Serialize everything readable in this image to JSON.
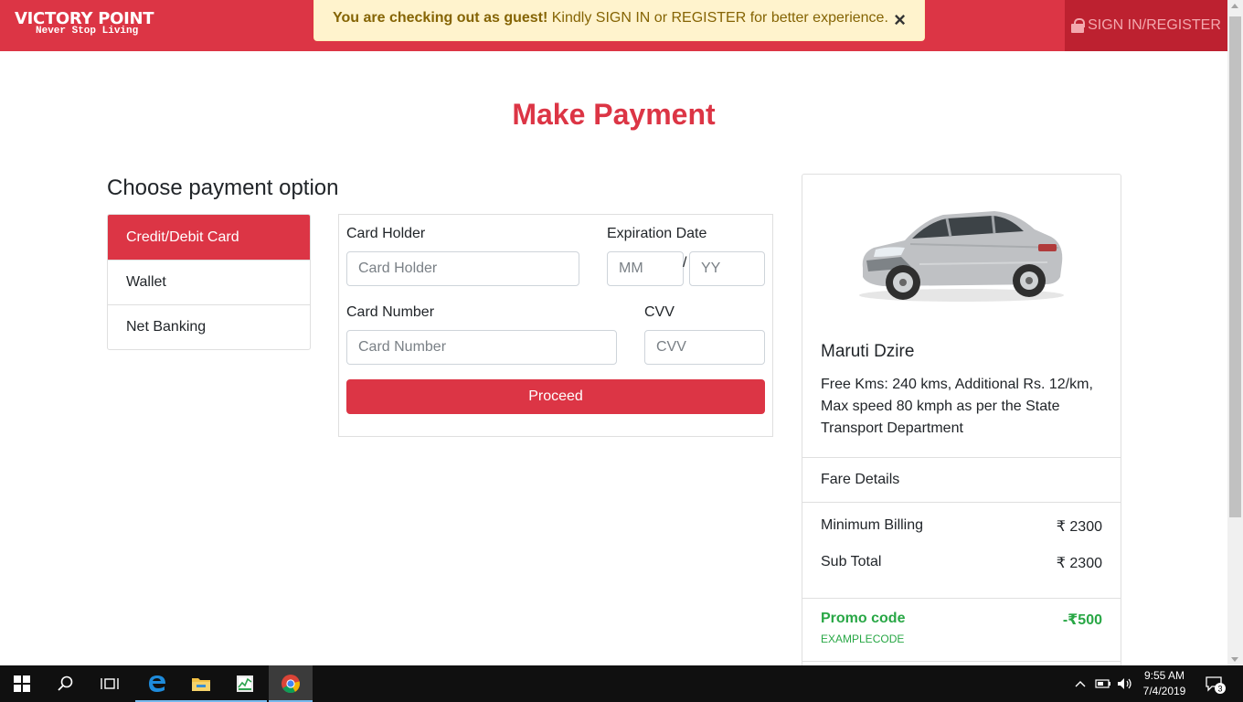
{
  "header": {
    "brand_name": "VICTORY POINT",
    "brand_tagline": "Never Stop Living",
    "alert_bold": "You are checking out as guest!",
    "alert_text": " Kindly SIGN IN or REGISTER for better experience.",
    "alert_close": "×",
    "signin_label": "SIGN IN/REGISTER"
  },
  "page_title": "Make Payment",
  "payment": {
    "section_title": "Choose payment option",
    "options": [
      {
        "label": "Credit/Debit Card",
        "active": true
      },
      {
        "label": "Wallet",
        "active": false
      },
      {
        "label": "Net Banking",
        "active": false
      }
    ]
  },
  "form": {
    "card_holder_label": "Card Holder",
    "card_holder_placeholder": "Card Holder",
    "expiration_label": "Expiration Date",
    "mm_placeholder": "MM",
    "separator": "/",
    "yy_placeholder": "YY",
    "card_number_label": "Card Number",
    "card_number_placeholder": "Card Number",
    "cvv_label": "CVV",
    "cvv_placeholder": "CVV",
    "proceed_label": "Proceed"
  },
  "summary": {
    "car_name": "Maruti Dzire",
    "car_description": "Free Kms: 240 kms, Additional Rs. 12/km, Max speed 80 kmph as per the State Transport Department",
    "fare_heading": "Fare Details",
    "minimum_billing_label": "Minimum Billing",
    "minimum_billing_value": "₹ 2300",
    "sub_total_label": "Sub Total",
    "sub_total_value": "₹ 2300",
    "promo_label": "Promo code",
    "promo_value": "-₹500",
    "promo_code": "EXAMPLECODE"
  },
  "taskbar": {
    "time": "9:55 AM",
    "date": "7/4/2019",
    "notification_count": "3"
  },
  "colors": {
    "brand_red": "#dc3545",
    "alert_bg": "#fff3cd",
    "promo_green": "#28a745"
  }
}
